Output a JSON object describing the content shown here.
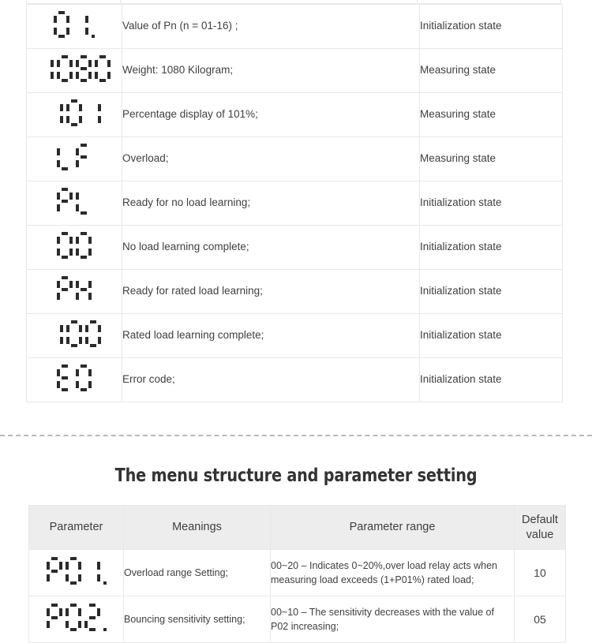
{
  "colors": {
    "text": "#3f3f3f",
    "segment": "#2b2b2b",
    "border": "#e8e8e8",
    "header_bg": "#ededed",
    "dashed": "#b8b8b8",
    "heading": "#333333"
  },
  "status_table": {
    "name": "status-code-table",
    "rows": [
      {
        "display": "01.",
        "description": "Value of Pn (n = 01-16) ;",
        "state": "Initialization state"
      },
      {
        "display": "1080",
        "description": "Weight: 1080 Kilogram;",
        "state": "Measuring state"
      },
      {
        "display": "101",
        "description": "Percentage display of 101%;",
        "state": "Measuring state"
      },
      {
        "display": "LF",
        "description": "Overload;",
        "state": "Measuring state"
      },
      {
        "display": "PL",
        "description": "Ready for no load learning;",
        "state": "Initialization state"
      },
      {
        "display": "00",
        "description": "No load learning complete;",
        "state": "Initialization state"
      },
      {
        "display": "PH",
        "description": "Ready for rated load learning;",
        "state": "Initialization state"
      },
      {
        "display": "100",
        "description": "Rated load learning complete;",
        "state": "Initialization state"
      },
      {
        "display": "E0",
        "description": "Error code;",
        "state": "Initialization state"
      }
    ]
  },
  "section": {
    "heading": "The menu structure and parameter setting"
  },
  "parameter_table": {
    "name": "parameter-setting-table",
    "headers": {
      "parameter": "Parameter",
      "meanings": "Meanings",
      "range": "Parameter range",
      "default": "Default value"
    },
    "rows": [
      {
        "display": "P01.",
        "meaning": "Overload range Setting;",
        "range": "00~20 – Indicates 0~20%,over load relay acts when measuring load exceeds (1+P01%) rated load;",
        "default": "10"
      },
      {
        "display": "P02.",
        "meaning": "Bouncing sensitivity setting;",
        "range": "00~10 – The sensitivity decreases with the value of P02 increasing;",
        "default": "05"
      }
    ]
  }
}
